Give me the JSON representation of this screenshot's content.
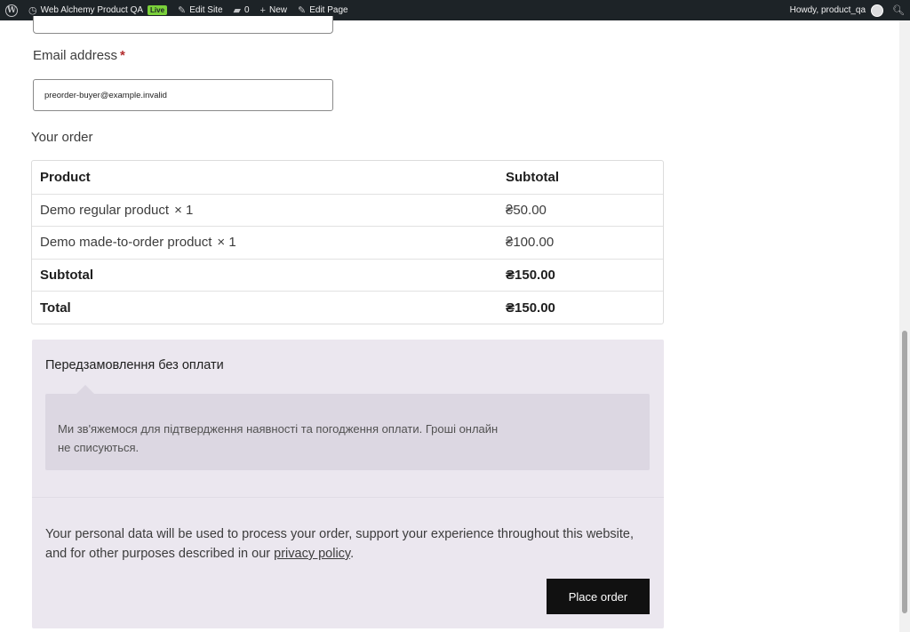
{
  "admin_bar": {
    "site_name": "Web Alchemy Product QA",
    "live_badge": "Live",
    "edit_site": "Edit Site",
    "comments_count": "0",
    "new": "New",
    "edit_page": "Edit Page",
    "howdy": "Howdy, product_qa"
  },
  "form": {
    "email_label": "Email address",
    "email_required_mark": "*",
    "email_value": "preorder-buyer@example.invalid"
  },
  "order": {
    "heading": "Your order",
    "header": {
      "product": "Product",
      "subtotal": "Subtotal"
    },
    "items": [
      {
        "name": "Demo regular product",
        "qty": "× 1",
        "subtotal": "₴50.00"
      },
      {
        "name": "Demo made-to-order product",
        "qty": "× 1",
        "subtotal": "₴100.00"
      }
    ],
    "subtotal_label": "Subtotal",
    "subtotal_value": "₴150.00",
    "total_label": "Total",
    "total_value": "₴150.00"
  },
  "payment": {
    "method_title": "Передзамовлення без оплати",
    "description_line1": "Ми зв'яжемося для підтвердження наявності та погодження оплати. Гроші онлайн",
    "description_line2": "не списуються.",
    "privacy_before": "Your personal data will be used to process your order, support your experience throughout this website, and for other purposes described in our ",
    "privacy_link": "privacy policy",
    "privacy_after": ".",
    "place_order": "Place order"
  },
  "colors": {
    "admin_bar_bg": "#1d2327",
    "payment_box_bg": "#ebe7ef",
    "payment_desc_bg": "#dcd7e2",
    "button_bg": "#111111",
    "required": "#b32d2e",
    "live_badge": "#7ad03a"
  }
}
